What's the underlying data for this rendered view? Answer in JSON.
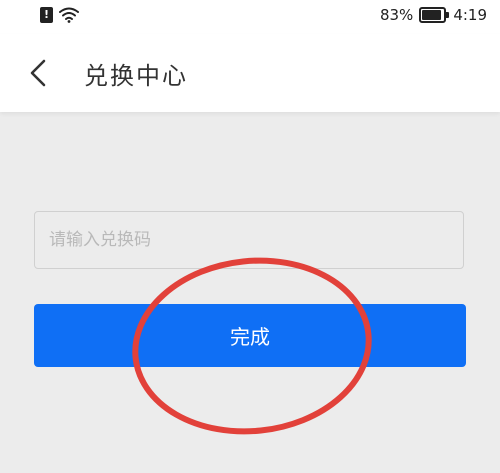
{
  "status_bar": {
    "alert_glyph": "!",
    "battery_percent": "83%",
    "battery_level": 0.83,
    "time": "4:19"
  },
  "nav": {
    "title": "兑换中心"
  },
  "form": {
    "code_placeholder": "请输入兑换码",
    "code_value": "",
    "done_label": "完成"
  },
  "colors": {
    "primary": "#0f6ff5",
    "background": "#ececec",
    "annotation": "#e2413a"
  },
  "icons": [
    "alert-icon",
    "wifi-icon",
    "battery-icon",
    "back-arrow-icon"
  ]
}
